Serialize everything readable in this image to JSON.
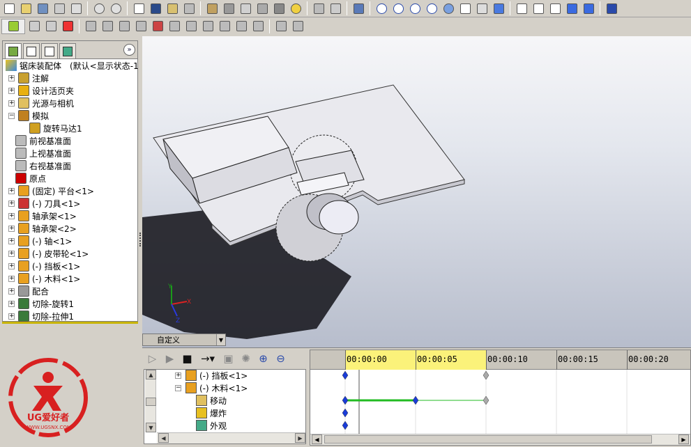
{
  "tree": {
    "tabs": [
      "featuremanager-icon",
      "propertymanager-icon",
      "configurationmanager-icon",
      "appearance-icon"
    ],
    "root": "锯床装配体　(默认<显示状态-1",
    "items": [
      {
        "label": "注解",
        "expand": "+",
        "indent": 0
      },
      {
        "label": "设计活页夹",
        "expand": "+",
        "indent": 0
      },
      {
        "label": "光源与相机",
        "expand": "+",
        "indent": 0
      },
      {
        "label": "模拟",
        "expand": "−",
        "indent": 0
      },
      {
        "label": "旋转马达1",
        "expand": "",
        "indent": 1
      },
      {
        "label": "前视基准面",
        "expand": "",
        "indent": 0
      },
      {
        "label": "上视基准面",
        "expand": "",
        "indent": 0
      },
      {
        "label": "右视基准面",
        "expand": "",
        "indent": 0
      },
      {
        "label": "原点",
        "expand": "",
        "indent": 0
      },
      {
        "label": "(固定) 平台<1>",
        "expand": "+",
        "indent": 0
      },
      {
        "label": "(-) 刀具<1>",
        "expand": "+",
        "indent": 0
      },
      {
        "label": "轴承架<1>",
        "expand": "+",
        "indent": 0
      },
      {
        "label": "轴承架<2>",
        "expand": "+",
        "indent": 0
      },
      {
        "label": "(-) 轴<1>",
        "expand": "+",
        "indent": 0
      },
      {
        "label": "(-) 皮带轮<1>",
        "expand": "+",
        "indent": 0
      },
      {
        "label": "(-) 挡板<1>",
        "expand": "+",
        "indent": 0
      },
      {
        "label": "(-) 木料<1>",
        "expand": "+",
        "indent": 0
      },
      {
        "label": "配合",
        "expand": "+",
        "indent": 0
      },
      {
        "label": "切除-旋转1",
        "expand": "+",
        "indent": 0
      },
      {
        "label": "切除-拉伸1",
        "expand": "+",
        "indent": 0
      }
    ]
  },
  "view_select": "自定义",
  "triad": {
    "x": "X",
    "y": "Y",
    "z": "Z"
  },
  "motion": {
    "rows": [
      {
        "label": "(-) 挡板<1>",
        "expand": "+"
      },
      {
        "label": "(-) 木料<1>",
        "expand": "−"
      },
      {
        "label": "移动",
        "expand": ""
      },
      {
        "label": "爆炸",
        "expand": ""
      },
      {
        "label": "外观",
        "expand": ""
      }
    ],
    "ruler": [
      "00:00:00",
      "00:00:05",
      "00:00:10",
      "00:00:15",
      "00:00:20"
    ]
  },
  "logo": {
    "brand": "UG爱好者",
    "url": "WWW.UGSNX.COM"
  },
  "colors": {
    "accent": "#c8b400",
    "timeline_highlight": "#fbf27a",
    "key_blue": "#1a3cd8",
    "bar_green": "#22bb22"
  }
}
